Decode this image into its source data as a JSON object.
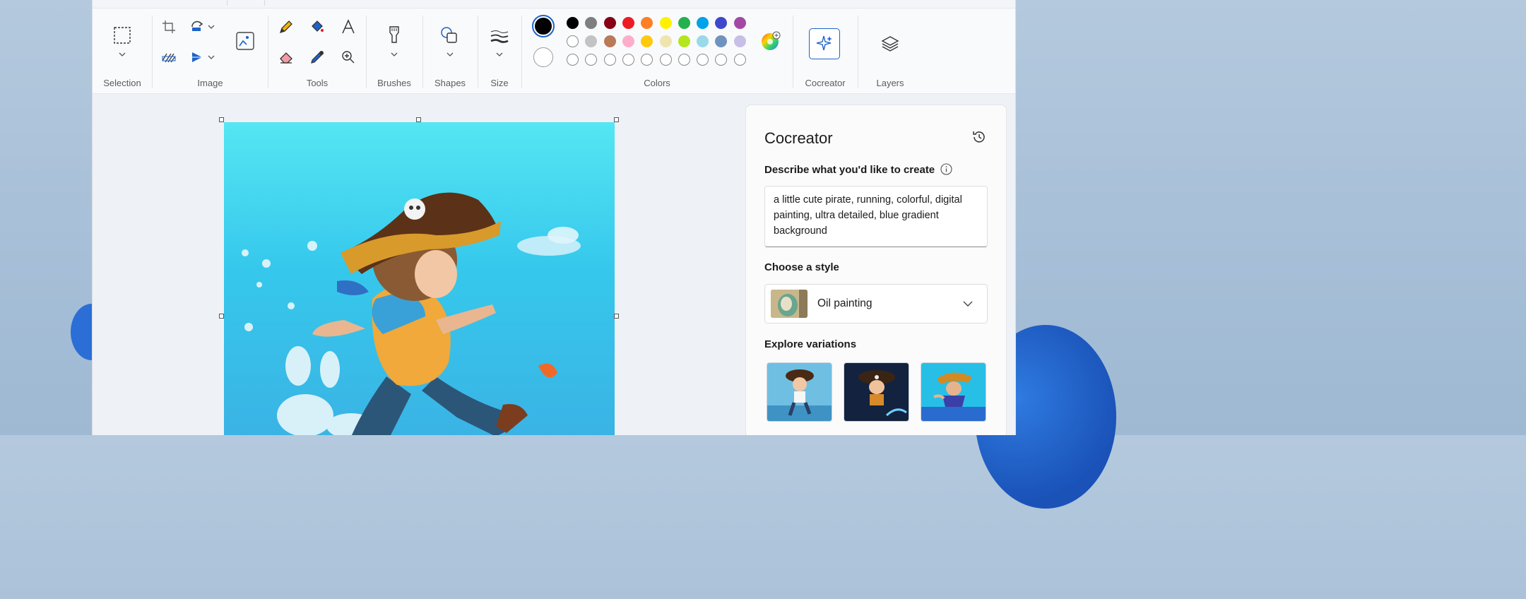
{
  "ribbon": {
    "groups": {
      "selection": "Selection",
      "image": "Image",
      "tools": "Tools",
      "brushes": "Brushes",
      "shapes": "Shapes",
      "size": "Size",
      "colors": "Colors",
      "cocreator": "Cocreator",
      "layers": "Layers"
    },
    "colors": {
      "primary": "#000000",
      "secondary": "#ffffff",
      "row1": [
        "#000000",
        "#7f7f7f",
        "#880015",
        "#ed1c24",
        "#ff7f27",
        "#fff200",
        "#22b14c",
        "#00a2e8",
        "#3f48cc",
        "#a349a4"
      ],
      "row2": [
        "#ffffff",
        "#c3c3c3",
        "#b97a57",
        "#ffaec9",
        "#ffc90e",
        "#efe4b0",
        "#b5e61d",
        "#99d9ea",
        "#7092be",
        "#c8bfe7"
      ],
      "row3_empty_count": 10
    },
    "icons": {
      "selection": "rectangle-select-icon",
      "crop": "crop-icon",
      "rotate": "rotate-icon",
      "background": "background-removal-icon",
      "flip": "flip-icon",
      "resize": "image-resize-icon",
      "pencil": "pencil-icon",
      "fill": "fill-bucket-icon",
      "text": "text-icon",
      "eraser": "eraser-icon",
      "picker": "color-picker-icon",
      "magnifier": "magnifier-icon",
      "brush": "brush-icon",
      "shapes": "shapes-icon",
      "size": "stroke-size-icon",
      "edit_colors": "edit-colors-icon",
      "cocreator": "cocreator-sparkle-icon",
      "layers": "layers-icon"
    }
  },
  "panel": {
    "title": "Cocreator",
    "history_icon": "history-icon",
    "describe_label": "Describe what you'd like to create",
    "info_icon": "info-icon",
    "prompt_text": "a little cute pirate, running, colorful, digital painting, ultra detailed, blue gradient background",
    "style_label": "Choose a style",
    "style_value": "Oil painting",
    "variations_label": "Explore variations"
  }
}
